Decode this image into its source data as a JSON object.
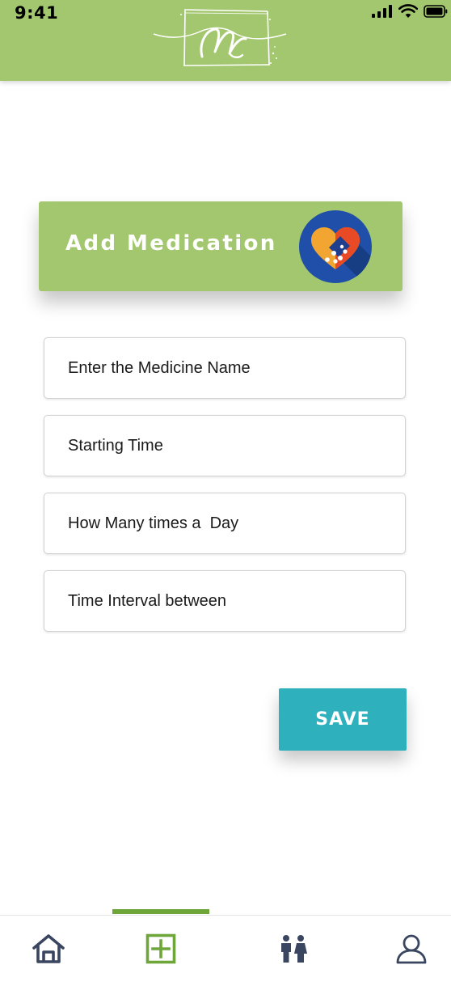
{
  "status_bar": {
    "time": "9:41",
    "icons": [
      "cellular-signal-icon",
      "wifi-icon",
      "battery-icon"
    ]
  },
  "header": {
    "logo": "app-logo"
  },
  "banner": {
    "title": "Add Medication",
    "icon": "medication-heart-icon"
  },
  "form": {
    "medicine_name": {
      "placeholder": "Enter the Medicine Name",
      "value": ""
    },
    "starting_time": {
      "placeholder": "Starting Time",
      "value": ""
    },
    "times_per_day": {
      "placeholder": "How Many times a  Day",
      "value": ""
    },
    "time_interval": {
      "placeholder": "Time Interval between",
      "value": ""
    }
  },
  "save_button": {
    "label": "SAVE"
  },
  "tab_bar": {
    "items": [
      {
        "name": "home",
        "icon": "home-icon",
        "active": false
      },
      {
        "name": "add",
        "icon": "add-square-icon",
        "active": true
      },
      {
        "name": "family",
        "icon": "family-icon",
        "active": false
      },
      {
        "name": "profile",
        "icon": "user-icon",
        "active": false
      }
    ]
  },
  "colors": {
    "header_green": "#a3c76e",
    "active_green": "#6ea63a",
    "save_teal": "#2eb0bd",
    "icon_navy": "#3a4660"
  }
}
